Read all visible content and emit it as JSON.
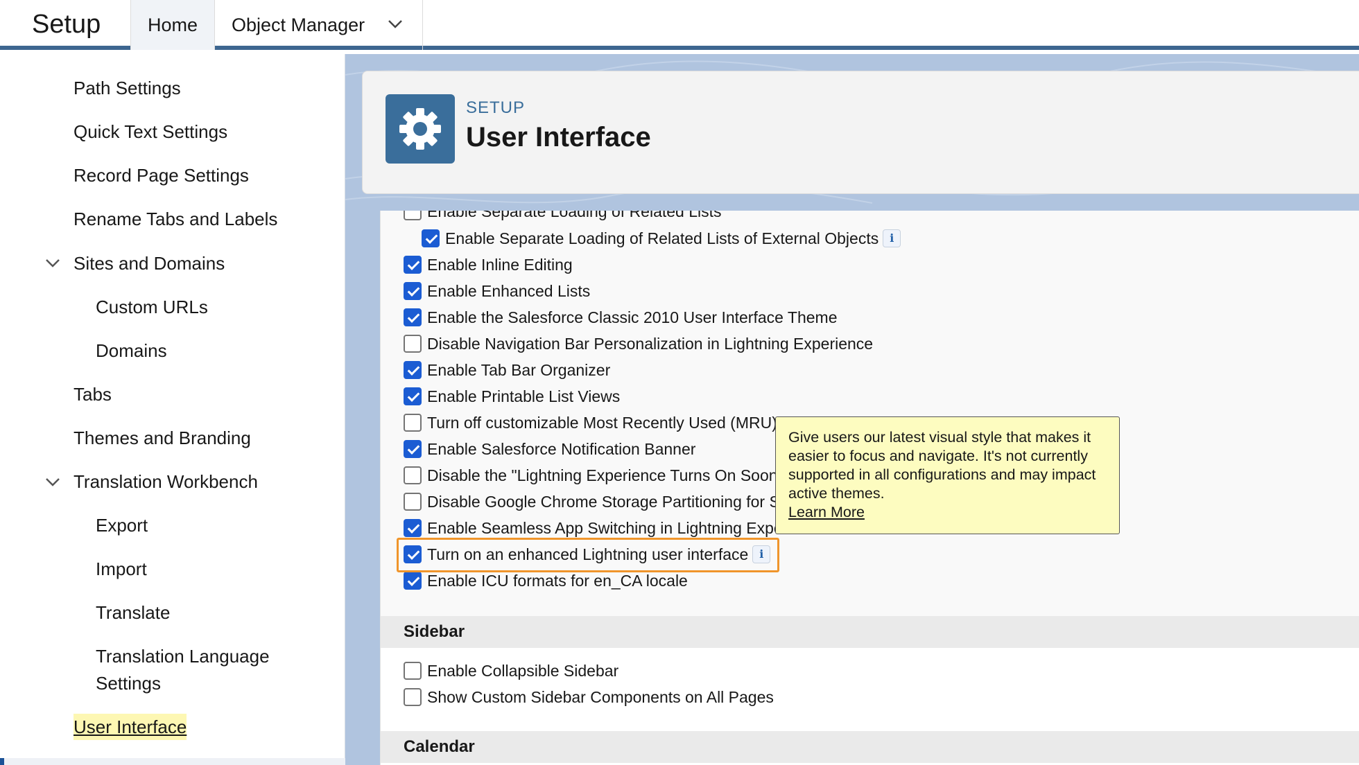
{
  "app": {
    "name": "Setup"
  },
  "tabs": {
    "home": "Home",
    "object_manager": "Object Manager"
  },
  "sidebar": {
    "items": [
      {
        "label": "Path Settings"
      },
      {
        "label": "Quick Text Settings"
      },
      {
        "label": "Record Page Settings"
      },
      {
        "label": "Rename Tabs and Labels"
      },
      {
        "label": "Sites and Domains"
      },
      {
        "label": "Custom URLs"
      },
      {
        "label": "Domains"
      },
      {
        "label": "Tabs"
      },
      {
        "label": "Themes and Branding"
      },
      {
        "label": "Translation Workbench"
      },
      {
        "label": "Export"
      },
      {
        "label": "Import"
      },
      {
        "label": "Translate"
      },
      {
        "label": "Translation Language"
      },
      {
        "label": "Settings"
      },
      {
        "label": "User Interface"
      }
    ]
  },
  "header": {
    "kicker": "SETUP",
    "title": "User Interface"
  },
  "settings": [
    {
      "label": "Enable Separate Loading of Related Lists",
      "checked": false
    },
    {
      "label": "Enable Separate Loading of Related Lists of External Objects",
      "checked": true
    },
    {
      "label": "Enable Inline Editing",
      "checked": true
    },
    {
      "label": "Enable Enhanced Lists",
      "checked": true
    },
    {
      "label": "Enable the Salesforce Classic 2010 User Interface Theme",
      "checked": true
    },
    {
      "label": "Disable Navigation Bar Personalization in Lightning Experience",
      "checked": false
    },
    {
      "label": "Enable Tab Bar Organizer",
      "checked": true
    },
    {
      "label": "Enable Printable List Views",
      "checked": true
    },
    {
      "label": "Turn off customizable Most Recently Used (MRU)",
      "checked": false
    },
    {
      "label": "Enable Salesforce Notification Banner",
      "checked": true
    },
    {
      "label": "Disable the \"Lightning Experience Turns On Soon\"",
      "checked": false
    },
    {
      "label": "Disable Google Chrome Storage Partitioning for S",
      "checked": false
    },
    {
      "label": "Enable Seamless App Switching in Lightning Expe",
      "checked": true
    },
    {
      "label": "Turn on an enhanced Lightning user interface",
      "checked": true
    },
    {
      "label": "Enable ICU formats for en_CA locale",
      "checked": true
    }
  ],
  "sections": {
    "sidebar": {
      "title": "Sidebar",
      "items": [
        {
          "label": "Enable Collapsible Sidebar",
          "checked": false
        },
        {
          "label": "Show Custom Sidebar Components on All Pages",
          "checked": false
        }
      ]
    },
    "calendar": {
      "title": "Calendar"
    }
  },
  "info_icon": "i",
  "tooltip": {
    "text": "Give users our latest visual style that makes it easier to focus and navigate. It's not currently supported in all configurations and may impact active themes.",
    "link": "Learn More"
  },
  "colors": {
    "brand": "#3a6e9b",
    "accent_border": "#3d6690",
    "checkbox": "#1b5cd3",
    "highlight": "#f0952b",
    "tooltip_bg": "#fdfcc0"
  }
}
